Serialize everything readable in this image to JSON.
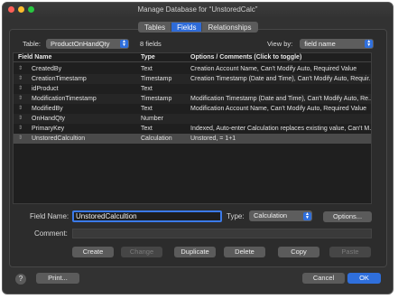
{
  "window": {
    "title": "Manage Database for “UnstoredCalc”"
  },
  "tabs": [
    {
      "label": "Tables",
      "active": false
    },
    {
      "label": "Fields",
      "active": true
    },
    {
      "label": "Relationships",
      "active": false
    }
  ],
  "table_selector": {
    "label": "Table:",
    "value": "ProductOnHandQty",
    "count": "8 fields"
  },
  "view_by": {
    "label": "View by:",
    "value": "field name"
  },
  "columns": [
    "Field Name",
    "Type",
    "Options / Comments   (Click to toggle)"
  ],
  "fields": [
    {
      "name": "CreatedBy",
      "type": "Text",
      "options": "Creation Account Name, Can't Modify Auto, Required Value"
    },
    {
      "name": "CreationTimestamp",
      "type": "Timestamp",
      "options": "Creation Timestamp (Date and Time), Can't Modify Auto, Requir..."
    },
    {
      "name": "idProduct",
      "type": "Text",
      "options": ""
    },
    {
      "name": "ModificationTimestamp",
      "type": "Timestamp",
      "options": "Modification Timestamp (Date and Time), Can't Modify Auto, Re..."
    },
    {
      "name": "ModifiedBy",
      "type": "Text",
      "options": "Modification Account Name, Can't Modify Auto, Required Value"
    },
    {
      "name": "OnHandQty",
      "type": "Number",
      "options": ""
    },
    {
      "name": "PrimaryKey",
      "type": "Text",
      "options": "Indexed, Auto-enter Calculation replaces existing value, Can't M..."
    },
    {
      "name": "UnstoredCalcultion",
      "type": "Calculation",
      "options": "Unstored, = 1+1"
    }
  ],
  "form": {
    "field_name_label": "Field Name:",
    "field_name_value": "UnstoredCalcultion",
    "type_label": "Type:",
    "type_value": "Calculation",
    "options_button": "Options...",
    "comment_label": "Comment:"
  },
  "actions": {
    "create": "Create",
    "change": "Change",
    "duplicate": "Duplicate",
    "delete": "Delete",
    "copy": "Copy",
    "paste": "Paste"
  },
  "footer": {
    "help": "?",
    "print": "Print...",
    "cancel": "Cancel",
    "ok": "OK"
  },
  "colors": {
    "accent": "#2f6fdc",
    "window_bg": "#323232",
    "table_bg": "#1f1f1f",
    "selected_row": "#4a4a4a"
  }
}
